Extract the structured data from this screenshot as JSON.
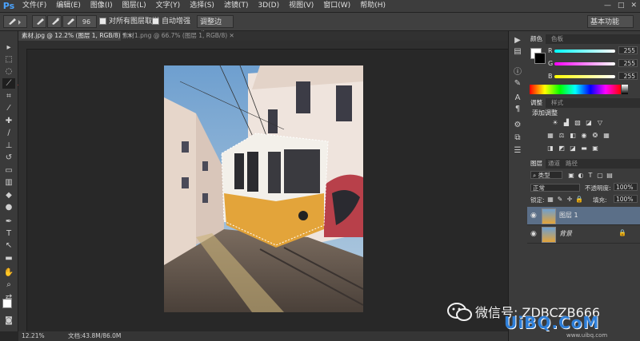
{
  "app": {
    "logo": "Ps"
  },
  "menu": [
    "文件(F)",
    "编辑(E)",
    "图像(I)",
    "图层(L)",
    "文字(Y)",
    "选择(S)",
    "滤镜(T)",
    "3D(D)",
    "视图(V)",
    "窗口(W)",
    "帮助(H)"
  ],
  "window_controls": [
    "—",
    "□",
    "✕"
  ],
  "options": {
    "brush_size": "96",
    "sample_all_layers": "对所有图层取样",
    "auto_enhance": "自动增强",
    "refine_edge": "调整边缘...",
    "workspace": "基本功能"
  },
  "tabs": [
    {
      "label": "素材.jpg @ 12.2% (图层 1, RGB/8) *",
      "active": true
    },
    {
      "label": "素材1.png @ 66.7% (图层 1, RGB/8)",
      "active": false
    }
  ],
  "status": {
    "zoom": "12.21%",
    "doc": "文档:43.8M/86.0M"
  },
  "color_panel": {
    "tabs": [
      "颜色",
      "色板"
    ],
    "channels": [
      {
        "label": "R",
        "value": "255",
        "color": "#ff5050"
      },
      {
        "label": "G",
        "value": "255",
        "color": "#55ff55"
      },
      {
        "label": "B",
        "value": "255",
        "color": "#5b78ff"
      }
    ]
  },
  "adjust_panel": {
    "tabs": [
      "调整",
      "样式"
    ],
    "title": "添加调整"
  },
  "layers_panel": {
    "tabs": [
      "图层",
      "通道",
      "路径"
    ],
    "kind_filter": "类型",
    "blend_mode": "正常",
    "opacity_label": "不透明度:",
    "opacity_value": "100%",
    "lock_label": "锁定:",
    "fill_label": "填充:",
    "fill_value": "100%",
    "layers": [
      {
        "name": "图层 1",
        "selected": true
      },
      {
        "name": "背景",
        "selected": false
      }
    ]
  },
  "watermark": {
    "text": "微信号: ZDBCZB666",
    "logo": "UiBQ.CoM",
    "url": "www.uibq.com"
  },
  "colors": {
    "accent_selected_layer": "#5b6f88",
    "ps_blue": "#4aa3ff",
    "arrow_red": "#d83a2e"
  }
}
